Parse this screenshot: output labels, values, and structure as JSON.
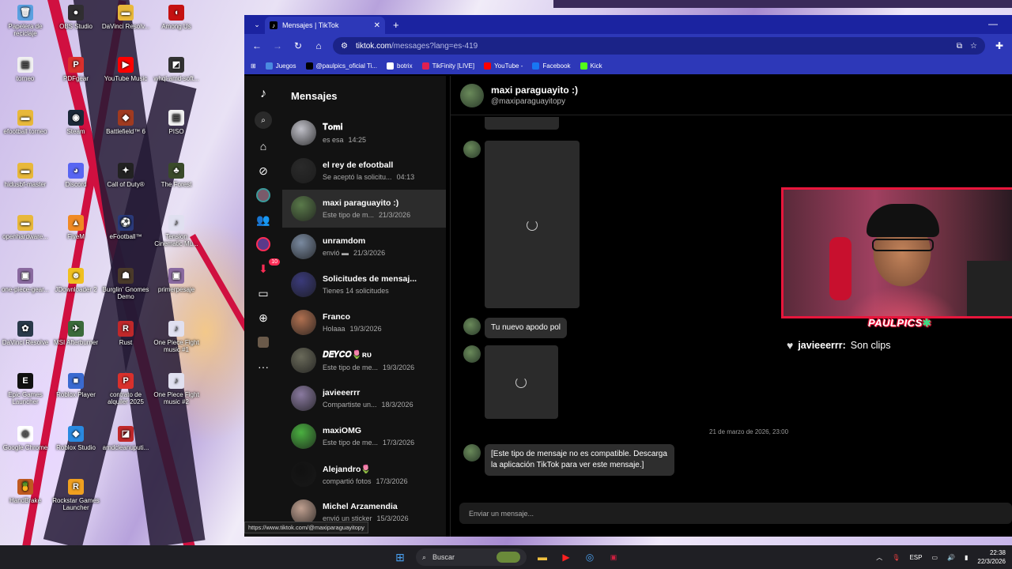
{
  "desktop_icons": [
    {
      "label": "Papelera de reciclaje",
      "icon": "recycle-bin-icon",
      "color": "#5aa0e0",
      "glyph": "🗑"
    },
    {
      "label": "OBS Studio",
      "icon": "obs-icon",
      "color": "#302e31",
      "glyph": "●"
    },
    {
      "label": "DaVinci Resolv...",
      "icon": "folder-icon",
      "color": "#e8b83a",
      "glyph": "▬"
    },
    {
      "label": "Among Us",
      "icon": "among-us-icon",
      "color": "#c51111",
      "glyph": "◖"
    },
    {
      "label": "torneo",
      "icon": "document-icon",
      "color": "#f0f0f0",
      "glyph": "▤"
    },
    {
      "label": "PDFgear",
      "icon": "pdf-icon",
      "color": "#d9302c",
      "glyph": "P"
    },
    {
      "label": "YouTube Music",
      "icon": "youtube-music-icon",
      "color": "#ff0000",
      "glyph": "▶"
    },
    {
      "label": "whql-amd-soft...",
      "icon": "installer-icon",
      "color": "#333333",
      "glyph": "◩"
    },
    {
      "label": "efootball torneo",
      "icon": "folder-icon",
      "color": "#e8b83a",
      "glyph": "▬"
    },
    {
      "label": "Steam",
      "icon": "steam-icon",
      "color": "#1b2838",
      "glyph": "◉"
    },
    {
      "label": "Battlefield™ 6",
      "icon": "battlefield-icon",
      "color": "#a03a20",
      "glyph": "◆"
    },
    {
      "label": "PISO",
      "icon": "document-icon",
      "color": "#f0f0f0",
      "glyph": "▤"
    },
    {
      "label": "hidusbf-master",
      "icon": "folder-icon",
      "color": "#e8b83a",
      "glyph": "▬"
    },
    {
      "label": "Discord",
      "icon": "discord-icon",
      "color": "#5865f2",
      "glyph": "◕"
    },
    {
      "label": "Call of Duty®",
      "icon": "cod-icon",
      "color": "#222222",
      "glyph": "✦"
    },
    {
      "label": "The Forest",
      "icon": "the-forest-icon",
      "color": "#3a4a2a",
      "glyph": "♣"
    },
    {
      "label": "openhardware...",
      "icon": "folder-icon",
      "color": "#e8b83a",
      "glyph": "▬"
    },
    {
      "label": "FiveM",
      "icon": "fivem-icon",
      "color": "#f08a24",
      "glyph": "▲"
    },
    {
      "label": "eFootball™",
      "icon": "efootball-icon",
      "color": "#2a3a7a",
      "glyph": "⚽"
    },
    {
      "label": "Tension Cinematic Mu...",
      "icon": "audio-file-icon",
      "color": "#e0e0f0",
      "glyph": "♪"
    },
    {
      "label": "one-piece-gear...",
      "icon": "image-file-icon",
      "color": "#8a6aa0",
      "glyph": "▣"
    },
    {
      "label": "JDownloader 2",
      "icon": "jdownloader-icon",
      "color": "#f0c020",
      "glyph": "☻"
    },
    {
      "label": "Burglin' Gnomes Demo",
      "icon": "burglin-gnomes-icon",
      "color": "#4a3a2a",
      "glyph": "☗"
    },
    {
      "label": "primerpesaje",
      "icon": "image-file-icon",
      "color": "#8a6aa0",
      "glyph": "▣"
    },
    {
      "label": "DaVinci Resolve",
      "icon": "davinci-icon",
      "color": "#2a3a4a",
      "glyph": "✿"
    },
    {
      "label": "MSI Afterburner",
      "icon": "msi-icon",
      "color": "#3a6a3a",
      "glyph": "✈"
    },
    {
      "label": "Rust",
      "icon": "rust-icon",
      "color": "#c0282a",
      "glyph": "R"
    },
    {
      "label": "One Piece Fight music #1",
      "icon": "audio-file-icon",
      "color": "#e0e0f0",
      "glyph": "♪"
    },
    {
      "label": "Epic Games Launcher",
      "icon": "epic-icon",
      "color": "#111111",
      "glyph": "E"
    },
    {
      "label": "Roblox Player",
      "icon": "roblox-icon",
      "color": "#3a6ad0",
      "glyph": "■"
    },
    {
      "label": "contrato de alquiler 2025",
      "icon": "pdf-icon",
      "color": "#d9302c",
      "glyph": "P"
    },
    {
      "label": "One Piece Fight music #2",
      "icon": "audio-file-icon",
      "color": "#e0e0f0",
      "glyph": "♪"
    },
    {
      "label": "Google Chrome",
      "icon": "chrome-icon",
      "color": "#ffffff",
      "glyph": "◎"
    },
    {
      "label": "Roblox Studio",
      "icon": "roblox-studio-icon",
      "color": "#2a8ae0",
      "glyph": "◆"
    },
    {
      "label": "amdcleanuputi...",
      "icon": "amd-icon",
      "color": "#c0282a",
      "glyph": "◪"
    },
    {
      "label": "",
      "icon": "blank-icon",
      "color": "transparent",
      "glyph": ""
    },
    {
      "label": "HandBrake",
      "icon": "handbrake-icon",
      "color": "#c05a20",
      "glyph": "🍍"
    },
    {
      "label": "Rockstar Games Launcher",
      "icon": "rockstar-icon",
      "color": "#f0a020",
      "glyph": "R"
    }
  ],
  "browser": {
    "tab_title": "Mensajes | TikTok",
    "url_host": "tiktok.com",
    "url_path": "/messages?lang=es-419",
    "bookmarks": [
      {
        "label": "Juegos",
        "color": "#4a8ae0"
      },
      {
        "label": "@paulpics_oficial Ti...",
        "color": "#000000"
      },
      {
        "label": "botrix",
        "color": "#ffffff"
      },
      {
        "label": "TikFinity [LIVE]",
        "color": "#e02050"
      },
      {
        "label": "YouTube -",
        "color": "#ff0000"
      },
      {
        "label": "Facebook",
        "color": "#1877f2"
      },
      {
        "label": "Kick",
        "color": "#53fc18"
      }
    ],
    "status_url": "https://www.tiktok.com/@maxiparaguayitopy"
  },
  "tiktok": {
    "messages_title": "Mensajes",
    "notif_count": "10",
    "conversations": [
      {
        "name": "𝐓𝐨𝐦𝐢",
        "preview": "es esa",
        "date": "14:25",
        "avatar": "#c0c0c8"
      },
      {
        "name": "el rey de efootball",
        "preview": "Se aceptó la solicitu...",
        "date": "04:13",
        "avatar": "#2a2a2a"
      },
      {
        "name": "maxi paraguayito :)",
        "preview": "Este tipo de m...",
        "date": "21/3/2026",
        "avatar": "#5a7a4a",
        "active": true
      },
      {
        "name": "unramdom",
        "preview": "envió ▬",
        "date": "21/3/2026",
        "avatar": "#7a8aa0"
      },
      {
        "name": "Solicitudes de mensaj...",
        "preview": "Tienes 14 solicitudes",
        "date": "",
        "avatar": "#3a3a7a"
      },
      {
        "name": "Franco",
        "preview": "Holaaa",
        "date": "19/3/2026",
        "avatar": "#b07050"
      },
      {
        "name": "𝑫𝑬𝒀𝑪𝑶🌷ʀᴜ",
        "preview": "Este tipo de me...",
        "date": "19/3/2026",
        "avatar": "#6a6a5a"
      },
      {
        "name": "javieeerrr",
        "preview": "Compartiste un...",
        "date": "18/3/2026",
        "avatar": "#8a7aa0"
      },
      {
        "name": "maxiOMG",
        "preview": "Este tipo de me...",
        "date": "17/3/2026",
        "avatar": "#4ab040"
      },
      {
        "name": "Alejandro🌷",
        "preview": "compartió fotos",
        "date": "17/3/2026",
        "avatar": "#111111"
      },
      {
        "name": "Michel Arzamendia",
        "preview": "envió un sticker",
        "date": "15/3/2026",
        "avatar": "#c0a090"
      }
    ],
    "chat": {
      "name": "maxi paraguayito :)",
      "username": "@maxiparaguayitopy",
      "message_1": "Tu nuevo apodo pol",
      "date_separator": "21 de marzo de 2026, 23:00",
      "message_2": "[Este tipo de mensaje no es compatible. Descarga la aplicación TikTok para ver este mensaje.]",
      "input_placeholder": "Enviar un mensaje..."
    }
  },
  "overlay": {
    "streamer_label": "PAULPICS",
    "chat_user": "javieeerrr:",
    "chat_text": "Son clips"
  },
  "taskbar": {
    "search_label": "Buscar",
    "language": "ESP",
    "time": "22:38",
    "date": "22/3/2026"
  }
}
